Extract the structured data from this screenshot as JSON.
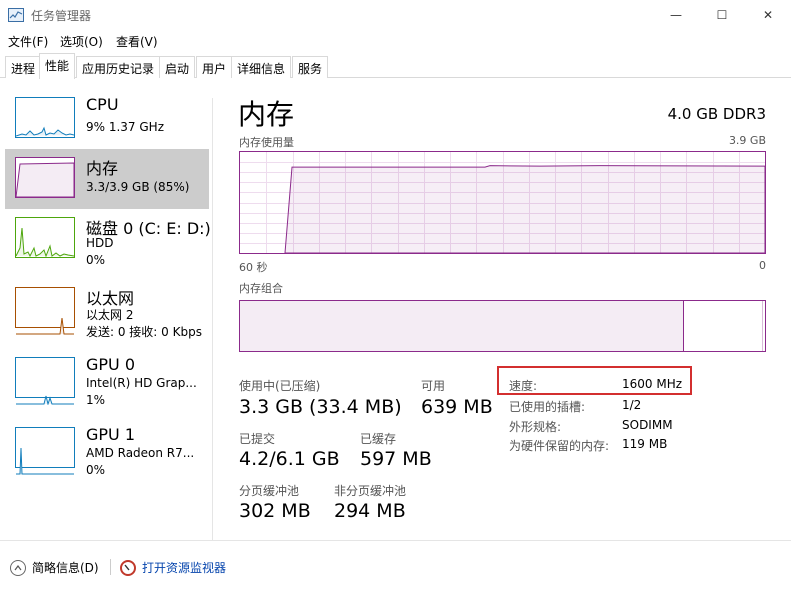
{
  "window": {
    "title": "任务管理器",
    "controls": {
      "minimize": "—",
      "maximize": "☐",
      "close": "✕"
    }
  },
  "menu": [
    "文件(F)",
    "选项(O)",
    "查看(V)"
  ],
  "tabs": [
    "进程",
    "性能",
    "应用历史记录",
    "启动",
    "用户",
    "详细信息",
    "服务"
  ],
  "active_tab": "性能",
  "sidebar": {
    "items": [
      {
        "title": "CPU",
        "line1": "9% 1.37 GHz",
        "line2": "",
        "color": "#117dbb",
        "icon": "cpu-graph-icon"
      },
      {
        "title": "内存",
        "line1": "3.3/3.9 GB (85%)",
        "line2": "",
        "color": "#8b2a8b",
        "icon": "memory-graph-icon"
      },
      {
        "title": "磁盘 0 (C: E: D:)",
        "line1": "HDD",
        "line2": "0%",
        "color": "#4da60c",
        "icon": "disk-graph-icon"
      },
      {
        "title": "以太网",
        "line1": "以太网 2",
        "line2": "发送: 0 接收: 0 Kbps",
        "color": "#a74f01",
        "icon": "ethernet-graph-icon"
      },
      {
        "title": "GPU 0",
        "line1": "Intel(R) HD Grap...",
        "line2": "1%",
        "color": "#117dbb",
        "icon": "gpu-graph-icon"
      },
      {
        "title": "GPU 1",
        "line1": "AMD Radeon R7...",
        "line2": "0%",
        "color": "#117dbb",
        "icon": "gpu-graph-icon"
      }
    ],
    "selected": "内存"
  },
  "main": {
    "title": "内存",
    "subtitle": "4.0 GB DDR3",
    "usage_label": "内存使用量",
    "usage_max": "3.9 GB",
    "time_left": "60 秒",
    "time_right": "0",
    "composition_label": "内存组合",
    "usage_fraction": 0.85,
    "in_use_fraction": 0.846,
    "stats": {
      "in_use_label": "使用中(已压缩)",
      "in_use_value": "3.3 GB (33.4 MB)",
      "available_label": "可用",
      "available_value": "639 MB",
      "committed_label": "已提交",
      "committed_value": "4.2/6.1 GB",
      "cached_label": "已缓存",
      "cached_value": "597 MB",
      "paged_label": "分页缓冲池",
      "paged_value": "302 MB",
      "nonpaged_label": "非分页缓冲池",
      "nonpaged_value": "294 MB"
    },
    "details": [
      {
        "label": "速度:",
        "value": "1600 MHz"
      },
      {
        "label": "已使用的插槽:",
        "value": "1/2"
      },
      {
        "label": "外形规格:",
        "value": "SODIMM"
      },
      {
        "label": "为硬件保留的内存:",
        "value": "119 MB"
      }
    ]
  },
  "bottom": {
    "fewer_details": "简略信息(D)",
    "resource_monitor": "打开资源监视器"
  },
  "colors": {
    "memory": "#8b2a8b",
    "highlight": "#d32f2f"
  }
}
